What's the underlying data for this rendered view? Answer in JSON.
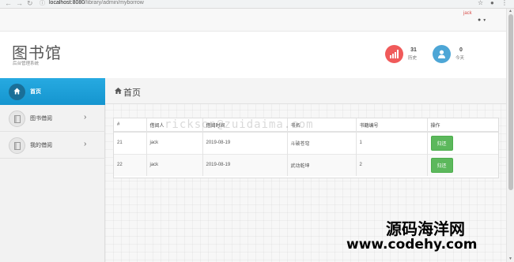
{
  "browser": {
    "url_host": "localhost:8080",
    "url_path": "/library/admin/myborrow"
  },
  "user": {
    "name": "jack"
  },
  "header": {
    "title": "图书馆",
    "subtitle": "后台管理系统",
    "stats": [
      {
        "value": "31",
        "label": "历史",
        "color": "#f05a5a"
      },
      {
        "value": "0",
        "label": "今天",
        "color": "#4da6d6"
      }
    ]
  },
  "sidebar": {
    "items": [
      {
        "label": "首页",
        "active": true
      },
      {
        "label": "图书借阅",
        "active": false
      },
      {
        "label": "我的借阅",
        "active": false
      }
    ]
  },
  "page": {
    "title": "首页"
  },
  "table": {
    "headers": [
      "#",
      "借阅人",
      "借阅时间",
      "书名",
      "书籍编号",
      "操作"
    ],
    "rows": [
      {
        "id": "21",
        "borrower": "jack",
        "date": "2019-08-19",
        "book": "斗破苍穹",
        "book_no": "1",
        "action": "归还"
      },
      {
        "id": "22",
        "borrower": "jack",
        "date": "2019-08-19",
        "book": "武动乾坤",
        "book_no": "2",
        "action": "归还"
      }
    ]
  },
  "watermarks": {
    "middle": "rickson@zuidaima.com",
    "chinese": "源码海洋网",
    "url": "www.codehy.com"
  },
  "colors": {
    "active_nav": "#1ba1dc",
    "return_button": "#5cb85c",
    "user_name": "#d9534f"
  }
}
